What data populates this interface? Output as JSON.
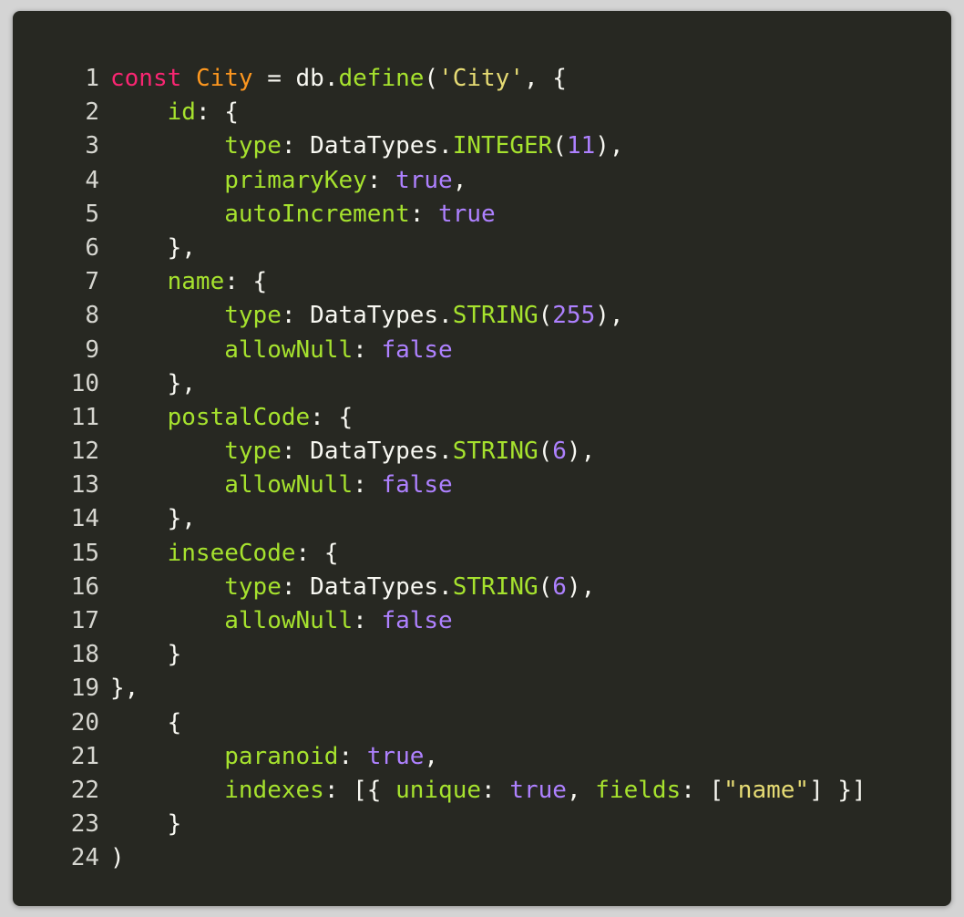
{
  "code_view": {
    "colors": {
      "background": "#272822",
      "keyword": "#f92672",
      "class_name": "#fd971f",
      "function_and_property": "#a6e22e",
      "string": "#e6db74",
      "number_and_boolean": "#ae81ff",
      "plain": "#f8f8f2"
    },
    "lines": [
      {
        "n": "1",
        "tokens": [
          [
            "kw",
            "const"
          ],
          [
            "plain",
            " "
          ],
          [
            "cls",
            "City"
          ],
          [
            "plain",
            " = db."
          ],
          [
            "fn",
            "define"
          ],
          [
            "plain",
            "("
          ],
          [
            "str",
            "'City'"
          ],
          [
            "plain",
            ", {"
          ]
        ]
      },
      {
        "n": "2",
        "tokens": [
          [
            "plain",
            "    "
          ],
          [
            "prop",
            "id"
          ],
          [
            "plain",
            ": {"
          ]
        ]
      },
      {
        "n": "3",
        "tokens": [
          [
            "plain",
            "        "
          ],
          [
            "prop",
            "type"
          ],
          [
            "plain",
            ": DataTypes."
          ],
          [
            "fn",
            "INTEGER"
          ],
          [
            "plain",
            "("
          ],
          [
            "num",
            "11"
          ],
          [
            "plain",
            "),"
          ]
        ]
      },
      {
        "n": "4",
        "tokens": [
          [
            "plain",
            "        "
          ],
          [
            "prop",
            "primaryKey"
          ],
          [
            "plain",
            ": "
          ],
          [
            "bool",
            "true"
          ],
          [
            "plain",
            ","
          ]
        ]
      },
      {
        "n": "5",
        "tokens": [
          [
            "plain",
            "        "
          ],
          [
            "prop",
            "autoIncrement"
          ],
          [
            "plain",
            ": "
          ],
          [
            "bool",
            "true"
          ]
        ]
      },
      {
        "n": "6",
        "tokens": [
          [
            "plain",
            "    },"
          ]
        ]
      },
      {
        "n": "7",
        "tokens": [
          [
            "plain",
            "    "
          ],
          [
            "prop",
            "name"
          ],
          [
            "plain",
            ": {"
          ]
        ]
      },
      {
        "n": "8",
        "tokens": [
          [
            "plain",
            "        "
          ],
          [
            "prop",
            "type"
          ],
          [
            "plain",
            ": DataTypes."
          ],
          [
            "fn",
            "STRING"
          ],
          [
            "plain",
            "("
          ],
          [
            "num",
            "255"
          ],
          [
            "plain",
            "),"
          ]
        ]
      },
      {
        "n": "9",
        "tokens": [
          [
            "plain",
            "        "
          ],
          [
            "prop",
            "allowNull"
          ],
          [
            "plain",
            ": "
          ],
          [
            "bool",
            "false"
          ]
        ]
      },
      {
        "n": "10",
        "tokens": [
          [
            "plain",
            "    },"
          ]
        ]
      },
      {
        "n": "11",
        "tokens": [
          [
            "plain",
            "    "
          ],
          [
            "prop",
            "postalCode"
          ],
          [
            "plain",
            ": {"
          ]
        ]
      },
      {
        "n": "12",
        "tokens": [
          [
            "plain",
            "        "
          ],
          [
            "prop",
            "type"
          ],
          [
            "plain",
            ": DataTypes."
          ],
          [
            "fn",
            "STRING"
          ],
          [
            "plain",
            "("
          ],
          [
            "num",
            "6"
          ],
          [
            "plain",
            "),"
          ]
        ]
      },
      {
        "n": "13",
        "tokens": [
          [
            "plain",
            "        "
          ],
          [
            "prop",
            "allowNull"
          ],
          [
            "plain",
            ": "
          ],
          [
            "bool",
            "false"
          ]
        ]
      },
      {
        "n": "14",
        "tokens": [
          [
            "plain",
            "    },"
          ]
        ]
      },
      {
        "n": "15",
        "tokens": [
          [
            "plain",
            "    "
          ],
          [
            "prop",
            "inseeCode"
          ],
          [
            "plain",
            ": {"
          ]
        ]
      },
      {
        "n": "16",
        "tokens": [
          [
            "plain",
            "        "
          ],
          [
            "prop",
            "type"
          ],
          [
            "plain",
            ": DataTypes."
          ],
          [
            "fn",
            "STRING"
          ],
          [
            "plain",
            "("
          ],
          [
            "num",
            "6"
          ],
          [
            "plain",
            "),"
          ]
        ]
      },
      {
        "n": "17",
        "tokens": [
          [
            "plain",
            "        "
          ],
          [
            "prop",
            "allowNull"
          ],
          [
            "plain",
            ": "
          ],
          [
            "bool",
            "false"
          ]
        ]
      },
      {
        "n": "18",
        "tokens": [
          [
            "plain",
            "    }"
          ]
        ]
      },
      {
        "n": "19",
        "tokens": [
          [
            "plain",
            "},"
          ]
        ]
      },
      {
        "n": "20",
        "tokens": [
          [
            "plain",
            "    {"
          ]
        ]
      },
      {
        "n": "21",
        "tokens": [
          [
            "plain",
            "        "
          ],
          [
            "prop",
            "paranoid"
          ],
          [
            "plain",
            ": "
          ],
          [
            "bool",
            "true"
          ],
          [
            "plain",
            ","
          ]
        ]
      },
      {
        "n": "22",
        "tokens": [
          [
            "plain",
            "        "
          ],
          [
            "prop",
            "indexes"
          ],
          [
            "plain",
            ": [{ "
          ],
          [
            "prop",
            "unique"
          ],
          [
            "plain",
            ": "
          ],
          [
            "bool",
            "true"
          ],
          [
            "plain",
            ", "
          ],
          [
            "prop",
            "fields"
          ],
          [
            "plain",
            ": ["
          ],
          [
            "str",
            "\"name\""
          ],
          [
            "plain",
            "] }]"
          ]
        ]
      },
      {
        "n": "23",
        "tokens": [
          [
            "plain",
            "    }"
          ]
        ]
      },
      {
        "n": "24",
        "tokens": [
          [
            "plain",
            ")"
          ]
        ]
      }
    ]
  }
}
